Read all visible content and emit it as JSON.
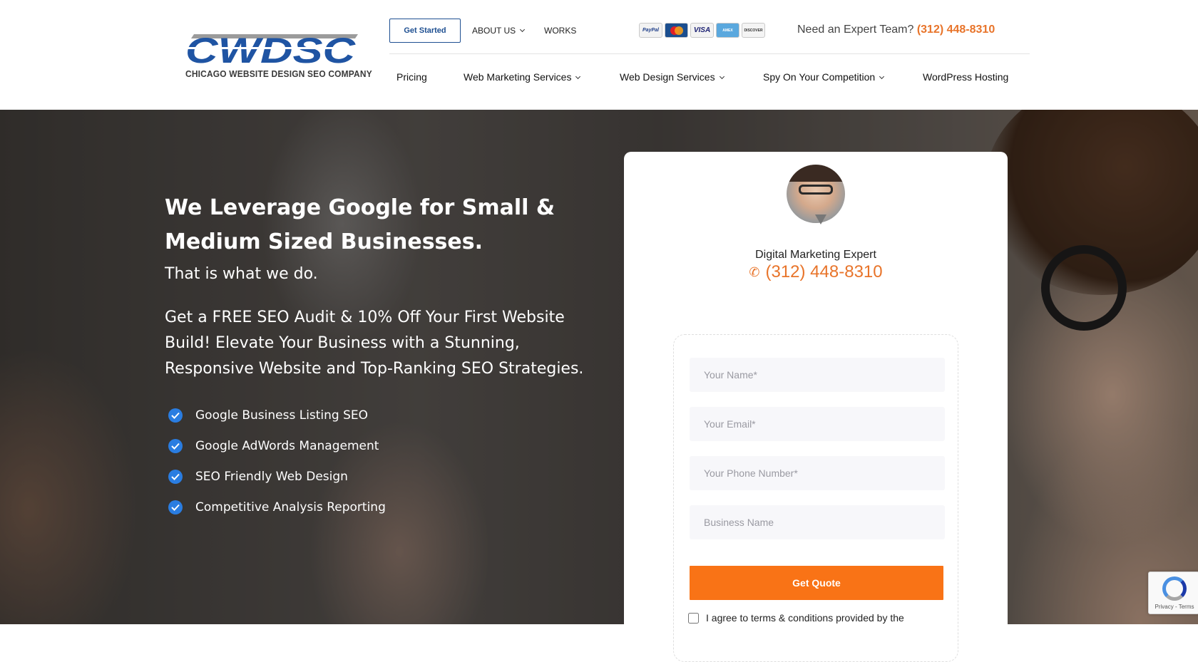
{
  "header": {
    "logo_text": "CWDSC",
    "logo_subtitle": "CHICAGO WEBSITE DESIGN SEO COMPANY",
    "get_started_label": "Get Started",
    "about_label": "ABOUT US",
    "works_label": "WORKS",
    "payment_cards": [
      "PayPal",
      "MasterCard",
      "VISA",
      "AMEX",
      "DISCOVER"
    ],
    "expert_text": "Need an Expert Team?",
    "expert_phone": "(312) 448-8310",
    "nav": {
      "pricing": "Pricing",
      "web_marketing": "Web Marketing Services",
      "web_design": "Web Design Services",
      "spy": "Spy On Your Competition",
      "wordpress": "WordPress Hosting"
    }
  },
  "hero": {
    "headline": "We Leverage Google for Small & Medium Sized Businesses.",
    "subheadline": "That is what we do.",
    "paragraph": "Get a FREE SEO Audit & 10% Off Your First Website Build! Elevate Your Business with a Stunning, Responsive Website and Top-Ranking SEO Strategies.",
    "features": [
      "Google Business Listing SEO",
      "Google AdWords Management",
      "SEO Friendly Web Design",
      "Competitive Analysis Reporting"
    ]
  },
  "quote_card": {
    "title": "Digital Marketing Expert",
    "phone": "(312) 448-8310",
    "fields": {
      "name": "Your Name*",
      "email": "Your Email*",
      "phone": "Your Phone Number*",
      "business": "Business Name"
    },
    "submit_label": "Get Quote",
    "agree_text": "I agree to terms & conditions provided by the"
  },
  "recaptcha": {
    "text": "Privacy - Terms"
  },
  "colors": {
    "accent": "#f97316",
    "brand_blue": "#1e4f91",
    "phone_orange": "#e8742a",
    "check_blue": "#2a7de1"
  }
}
